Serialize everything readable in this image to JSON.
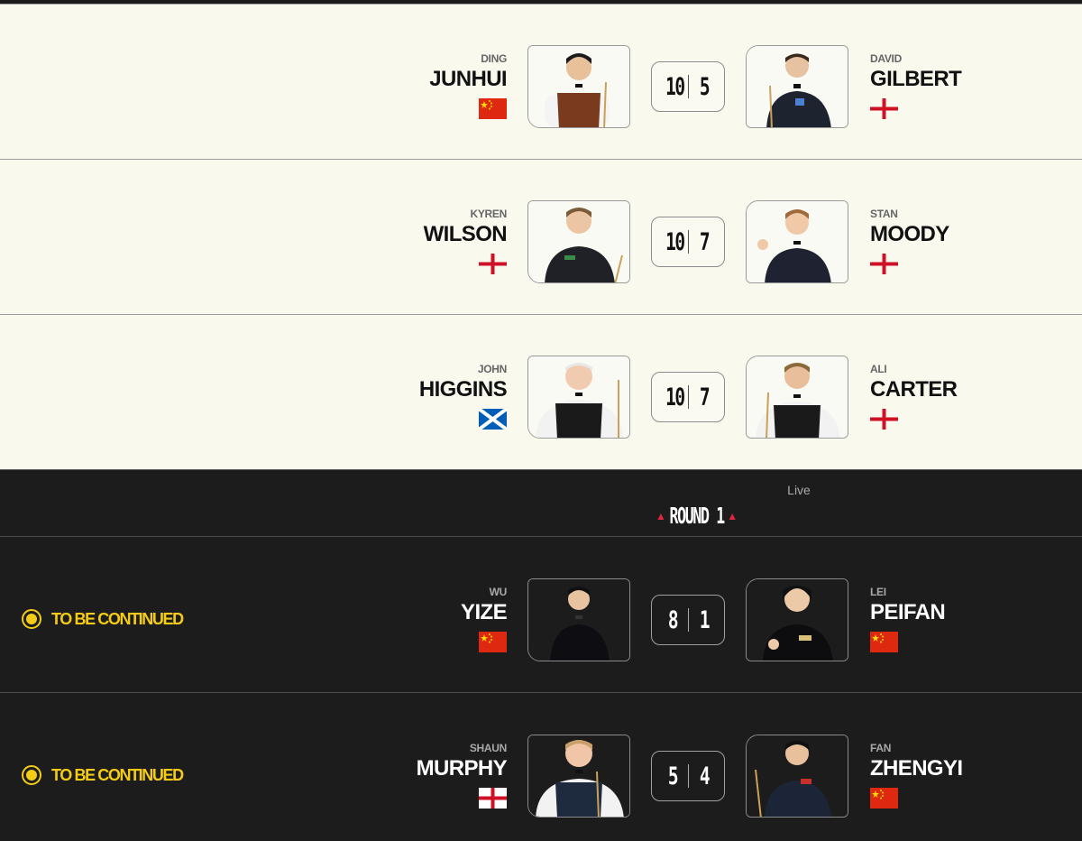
{
  "round": {
    "status": "Live",
    "title": "ROUND 1",
    "accent": "#e0273d"
  },
  "status_color": "#f4cc15",
  "matches": [
    {
      "theme": "light",
      "status": "",
      "left": {
        "first": "DING",
        "last": "JUNHUI",
        "flag": "china"
      },
      "right": {
        "first": "DAVID",
        "last": "GILBERT",
        "flag": "england"
      },
      "score_left": "10",
      "score_right": "5"
    },
    {
      "theme": "light",
      "status": "",
      "left": {
        "first": "KYREN",
        "last": "WILSON",
        "flag": "england"
      },
      "right": {
        "first": "STAN",
        "last": "MOODY",
        "flag": "england"
      },
      "score_left": "10",
      "score_right": "7"
    },
    {
      "theme": "light",
      "status": "",
      "left": {
        "first": "JOHN",
        "last": "HIGGINS",
        "flag": "scotland"
      },
      "right": {
        "first": "ALI",
        "last": "CARTER",
        "flag": "england"
      },
      "score_left": "10",
      "score_right": "7"
    },
    {
      "theme": "dark",
      "status": "TO BE CONTINUED",
      "left": {
        "first": "WU",
        "last": "YIZE",
        "flag": "china"
      },
      "right": {
        "first": "LEI",
        "last": "PEIFAN",
        "flag": "china"
      },
      "score_left": "8",
      "score_right": "1"
    },
    {
      "theme": "dark",
      "status": "TO BE CONTINUED",
      "left": {
        "first": "SHAUN",
        "last": "MURPHY",
        "flag": "england"
      },
      "right": {
        "first": "FAN",
        "last": "ZHENGYI",
        "flag": "china"
      },
      "score_left": "5",
      "score_right": "4"
    }
  ]
}
